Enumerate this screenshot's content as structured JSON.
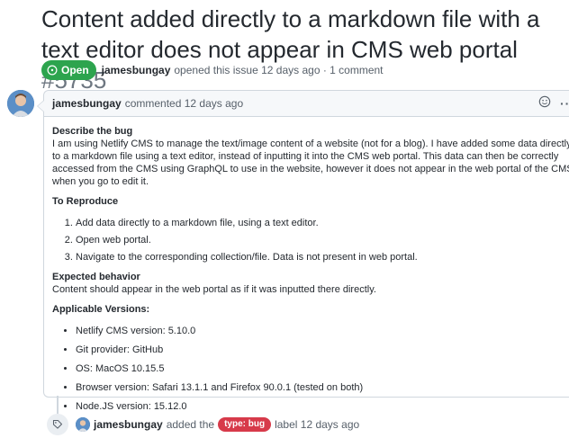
{
  "issue": {
    "title": "Content added directly to a markdown file with a text editor does not appear in CMS web portal",
    "number": "#5735",
    "state": "Open",
    "author": "jamesbungay",
    "meta_text": "opened this issue 12 days ago · 1 comment"
  },
  "comment": {
    "author": "jamesbungay",
    "header_text": "commented 12 days ago",
    "reaction_icon": "smiley-icon",
    "menu_label": "···",
    "bug_heading": "Describe the bug",
    "bug_text": "I am using Netlify CMS to manage the text/image content of a website (not for a blog). I have added some data directly to a markdown file using a text editor, instead of inputting it into the CMS web portal. This data can then be correctly accessed from the CMS using GraphQL to use in the website, however it does not appear in the web portal of the CMS when you go to edit it.",
    "reproduce_heading": "To Reproduce",
    "steps": [
      "Add data directly to a markdown file, using a text editor.",
      "Open web portal.",
      "Navigate to the corresponding collection/file. Data is not present in web portal."
    ],
    "expected_heading": "Expected behavior",
    "expected_text": "Content should appear in the web portal as if it was inputted there directly.",
    "versions_heading": "Applicable Versions:",
    "versions": [
      "Netlify CMS version: 5.10.0",
      "Git provider: GitHub",
      "OS: MacOS 10.15.5",
      "Browser version: Safari 13.1.1 and Firefox 90.0.1 (tested on both)",
      "Node.JS version: 15.12.0"
    ]
  },
  "event": {
    "icon": "tag-icon",
    "author": "jamesbungay",
    "action": "added the",
    "label": "type: bug",
    "label_color": "#d73a4a",
    "suffix": "label 12 days ago"
  },
  "colors": {
    "open_green": "#2da44e",
    "border": "#d0d7de",
    "header_bg": "#f6f8fa"
  }
}
